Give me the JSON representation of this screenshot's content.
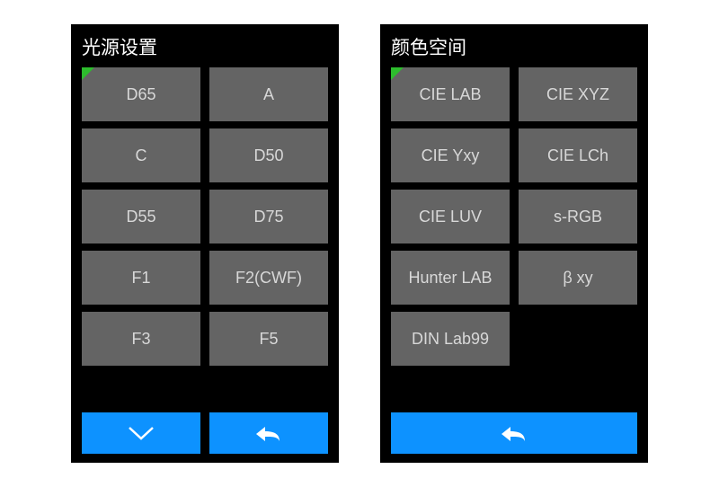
{
  "panels": {
    "light": {
      "title": "光源设置",
      "options": [
        "D65",
        "A",
        "C",
        "D50",
        "D55",
        "D75",
        "F1",
        "F2(CWF)",
        "F3",
        "F5"
      ],
      "footer": {
        "down": true,
        "back": true
      }
    },
    "colorspace": {
      "title": "颜色空间",
      "options": [
        "CIE LAB",
        "CIE XYZ",
        "CIE Yxy",
        "CIE LCh",
        "CIE LUV",
        "s-RGB",
        "Hunter LAB",
        "β xy",
        "DIN Lab99"
      ],
      "footer": {
        "back_full": true
      }
    }
  },
  "colors": {
    "panel_bg": "#000000",
    "option_bg": "#646464",
    "option_fg": "#d8d8d8",
    "accent": "#0d92ff",
    "marker": "#2dbd2d"
  }
}
